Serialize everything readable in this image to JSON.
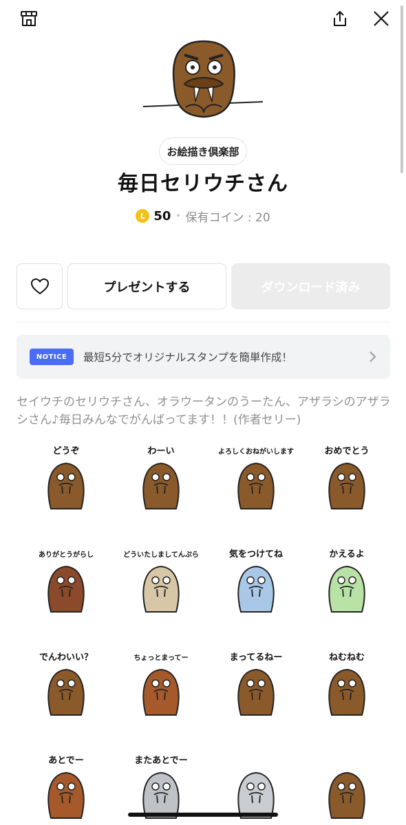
{
  "header": {
    "store_icon": "shop-icon",
    "share_icon": "share-icon",
    "close_icon": "close-icon"
  },
  "package": {
    "author": "お絵描き倶楽部",
    "title": "毎日セリウチさん",
    "coin_symbol": "L",
    "price": "50",
    "separator": "•",
    "owned_coins": "保有コイン : 20"
  },
  "actions": {
    "favorite_icon": "heart-icon",
    "present_label": "プレゼントする",
    "download_label": "ダウンロード済み"
  },
  "notice": {
    "badge": "NOTICE",
    "text": "最短5分でオリジナルスタンプを簡単作成！"
  },
  "description": "セイウチのセリウチさん、オラウータンのうーたん、アザラシのアザラシさん♪毎日みんなでがんばってます！！(作者セリー)",
  "stickers": [
    {
      "caption": "どうぞ"
    },
    {
      "caption": "わーい"
    },
    {
      "caption": "よろしくおねがいします"
    },
    {
      "caption": "おめでとう"
    },
    {
      "caption": "ありがとうがらし"
    },
    {
      "caption": "どういたしましてんぷら"
    },
    {
      "caption": "気をつけてね"
    },
    {
      "caption": "かえるよ"
    },
    {
      "caption": "でんわいい？"
    },
    {
      "caption": "ちょっとまってー"
    },
    {
      "caption": "まってるねー"
    },
    {
      "caption": "ねむねむ"
    },
    {
      "caption": "あとでー"
    },
    {
      "caption": "またあとでー"
    },
    {
      "caption": ""
    },
    {
      "caption": ""
    }
  ],
  "colors": {
    "walrus_brown": "#8b5a2b",
    "coin_yellow": "#f2c21b",
    "notice_blue": "#4a6cf7"
  }
}
